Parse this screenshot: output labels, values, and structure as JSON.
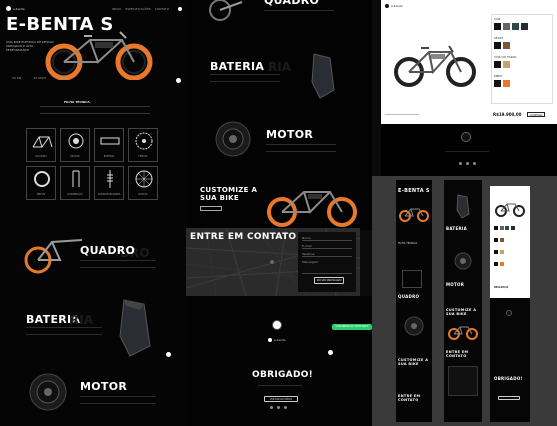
{
  "brand": {
    "name": "E-BENTA S",
    "name_small": "e-benta"
  },
  "hero": {
    "title": "E-BENTA S",
    "subtitle": "UMA BIKE ELÉTRICA DE DESIGN ARROJADO E ALTA PERFORMANCE",
    "nav": [
      "INÍCIO",
      "ESPECIFICAÇÕES",
      "CONTATO"
    ],
    "stats": [
      "90 KM",
      "45 KM/H",
      "750W"
    ]
  },
  "ficha": {
    "title": "FICHA TÉCNICA",
    "items": [
      "QUADRO",
      "MOTOR",
      "BATERIA",
      "FREIOS",
      "",
      "PNEUS",
      "SUSPENSÃO",
      "AMORTECEDORES",
      "RODAS"
    ]
  },
  "sections": {
    "quadro": "QUADRO",
    "bateria": "BATERIA",
    "motor": "MOTOR",
    "customize": "CUSTOMIZE A SUA BIKE",
    "contato": "ENTRE EM CONTATO",
    "obrigado": "OBRIGADO!"
  },
  "customize_panel": {
    "labels": [
      "COR",
      "SELIM",
      "COR DO FAROL",
      "PNEU"
    ],
    "price": "R$19.900,00",
    "button": "COMPRAR"
  },
  "contact_form": {
    "fields": [
      "Nome",
      "E-mail",
      "Telefone",
      "Mensagem"
    ],
    "button": "ENVIAR MENSAGEM"
  },
  "obrigado_button": "VOLTAR AO INÍCIO",
  "whatsapp_button": "CONVERSE NO WHATSAPP",
  "colors": {
    "accent": "#e8782a",
    "whatsapp": "#2ecc71",
    "background": "#000000"
  }
}
